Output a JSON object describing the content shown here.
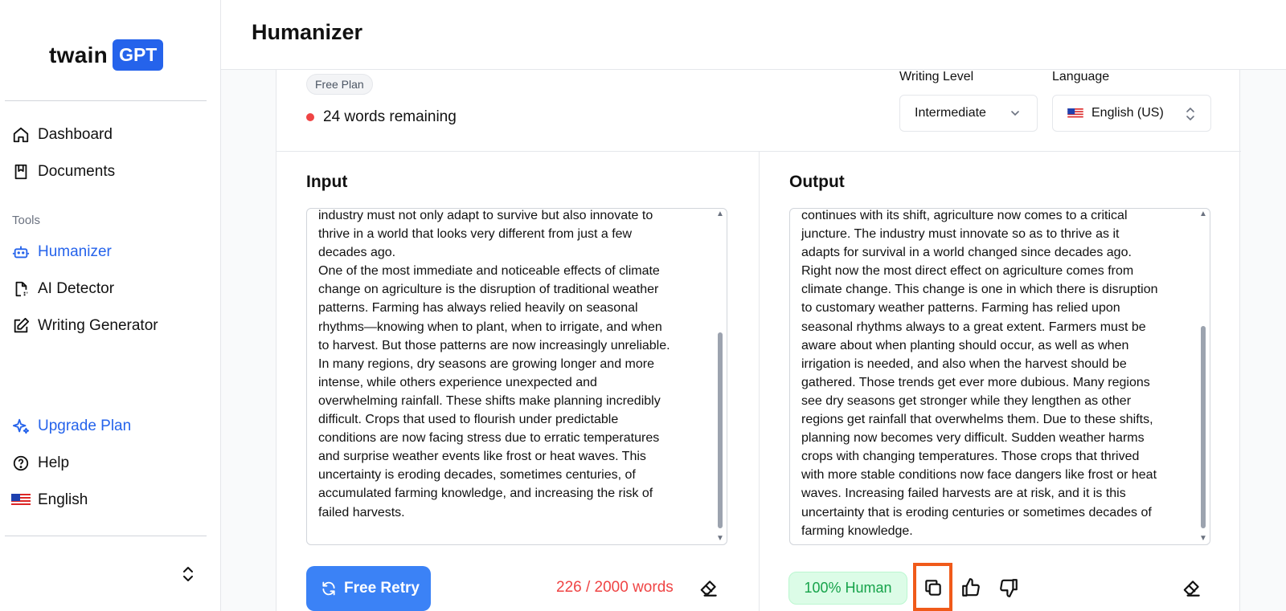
{
  "sidebar": {
    "logo_text": "twain",
    "logo_badge": "GPT",
    "nav": [
      {
        "label": "Dashboard",
        "icon": "home-icon"
      },
      {
        "label": "Documents",
        "icon": "document-icon"
      }
    ],
    "tools_label": "Tools",
    "tools": [
      {
        "label": "Humanizer",
        "icon": "robot-icon",
        "active": true
      },
      {
        "label": "AI Detector",
        "icon": "file-scan-icon"
      },
      {
        "label": "Writing Generator",
        "icon": "pencil-square-icon"
      }
    ],
    "bottom": [
      {
        "label": "Upgrade Plan",
        "icon": "sparkles-icon"
      },
      {
        "label": "Help",
        "icon": "help-circle-icon"
      },
      {
        "label": "English",
        "icon": "us-flag-icon"
      }
    ]
  },
  "header": {
    "title": "Humanizer"
  },
  "plan": {
    "badge": "Free Plan",
    "words_remaining": "24 words remaining"
  },
  "settings": {
    "writing_level_label": "Writing Level",
    "writing_level_value": "Intermediate",
    "language_label": "Language",
    "language_value": "English (US)"
  },
  "input": {
    "title": "Input",
    "text": "industry must not only adapt to survive but also innovate to\nthrive in a world that looks very different from just a few\ndecades ago.\nOne of the most immediate and noticeable effects of climate\nchange on agriculture is the disruption of traditional weather\npatterns. Farming has always relied heavily on seasonal\nrhythms—knowing when to plant, when to irrigate, and when\nto harvest. But those patterns are now increasingly unreliable.\nIn many regions, dry seasons are growing longer and more\nintense, while others experience unexpected and\noverwhelming rainfall. These shifts make planning incredibly\ndifficult. Crops that used to flourish under predictable\nconditions are now facing stress due to erratic temperatures\nand surprise weather events like frost or heat waves. This\nuncertainty is eroding decades, sometimes centuries, of\naccumulated farming knowledge, and increasing the risk of\nfailed harvests.",
    "retry_label": "Free Retry",
    "word_count": "226 / 2000 words"
  },
  "output": {
    "title": "Output",
    "text": "continues with its shift, agriculture now comes to a critical\njuncture. The industry must innovate so as to thrive as it\nadapts for survival in a world changed since decades ago.\nRight now the most direct effect on agriculture comes from\nclimate change. This change is one in which there is disruption\nto customary weather patterns. Farming has relied upon\nseasonal rhythms always to a great extent. Farmers must be\naware about when planting should occur, as well as when\nirrigation is needed, and also when the harvest should be\ngathered. Those trends get ever more dubious. Many regions\nsee dry seasons get stronger while they lengthen as other\nregions get rainfall that overwhelms them. Due to these shifts,\nplanning now becomes very difficult. Sudden weather harms\ncrops with changing temperatures. Those crops that thrived\nwith more stable conditions now face dangers like frost or heat\nwaves. Increasing failed harvests are at risk, and it is this\nuncertainty that is eroding centuries or sometimes decades of\nfarming knowledge.",
    "human_badge": "100% Human"
  },
  "colors": {
    "accent": "#2563eb",
    "retry": "#3b82f6",
    "danger": "#ef4444",
    "success": "#16a34a",
    "highlight": "#f05a1a"
  }
}
